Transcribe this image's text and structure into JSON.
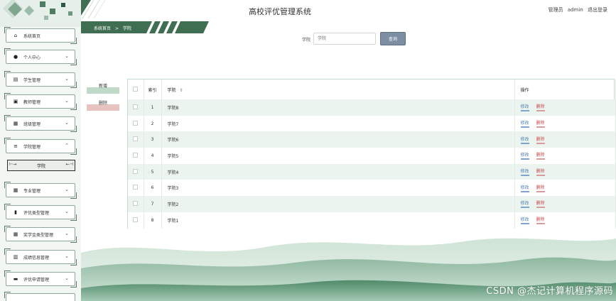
{
  "header": {
    "title": "高校评优管理系统",
    "user_role": "管理员",
    "user_name": "admin",
    "logout": "退出登录"
  },
  "breadcrumb": {
    "home": "系统首页",
    "separator": ">",
    "current": "学院"
  },
  "sidebar": {
    "items": [
      {
        "label": "系统首页",
        "icon": "home-icon"
      },
      {
        "label": "个人中心",
        "icon": "user-icon"
      },
      {
        "label": "学生管理",
        "icon": "doc-icon"
      },
      {
        "label": "教师管理",
        "icon": "chart-icon"
      },
      {
        "label": "班级管理",
        "icon": "grid-icon"
      },
      {
        "label": "学院管理",
        "icon": "list-icon"
      },
      {
        "label": "专业管理",
        "icon": "grid-icon"
      },
      {
        "label": "评优类型管理",
        "icon": "bar-chart-icon"
      },
      {
        "label": "奖学金类型管理",
        "icon": "grid-icon"
      },
      {
        "label": "成绩信息管理",
        "icon": "stats-icon"
      },
      {
        "label": "评优申请管理",
        "icon": "comment-icon"
      }
    ],
    "sub_item": "学院"
  },
  "search": {
    "label": "学院",
    "placeholder": "学院",
    "button": "查询"
  },
  "actions": {
    "add": "新增",
    "delete": "删除"
  },
  "table": {
    "headers": {
      "index": "索引",
      "college": "学院",
      "sort_icon": "⇕",
      "operation": "操作"
    },
    "edit_label": "修改",
    "delete_label": "删除",
    "rows": [
      {
        "index": "1",
        "college": "学院8"
      },
      {
        "index": "2",
        "college": "学院7"
      },
      {
        "index": "3",
        "college": "学院6"
      },
      {
        "index": "4",
        "college": "学院5"
      },
      {
        "index": "5",
        "college": "学院4"
      },
      {
        "index": "6",
        "college": "学院3"
      },
      {
        "index": "7",
        "college": "学院2"
      },
      {
        "index": "8",
        "college": "学院1"
      }
    ]
  },
  "watermark": "CSDN @杰记计算机程序源码",
  "colors": {
    "accent": "#3f6e52",
    "row_alt": "#ecf4ef",
    "edit": "#4c7fb3",
    "delete": "#c74b4b"
  }
}
